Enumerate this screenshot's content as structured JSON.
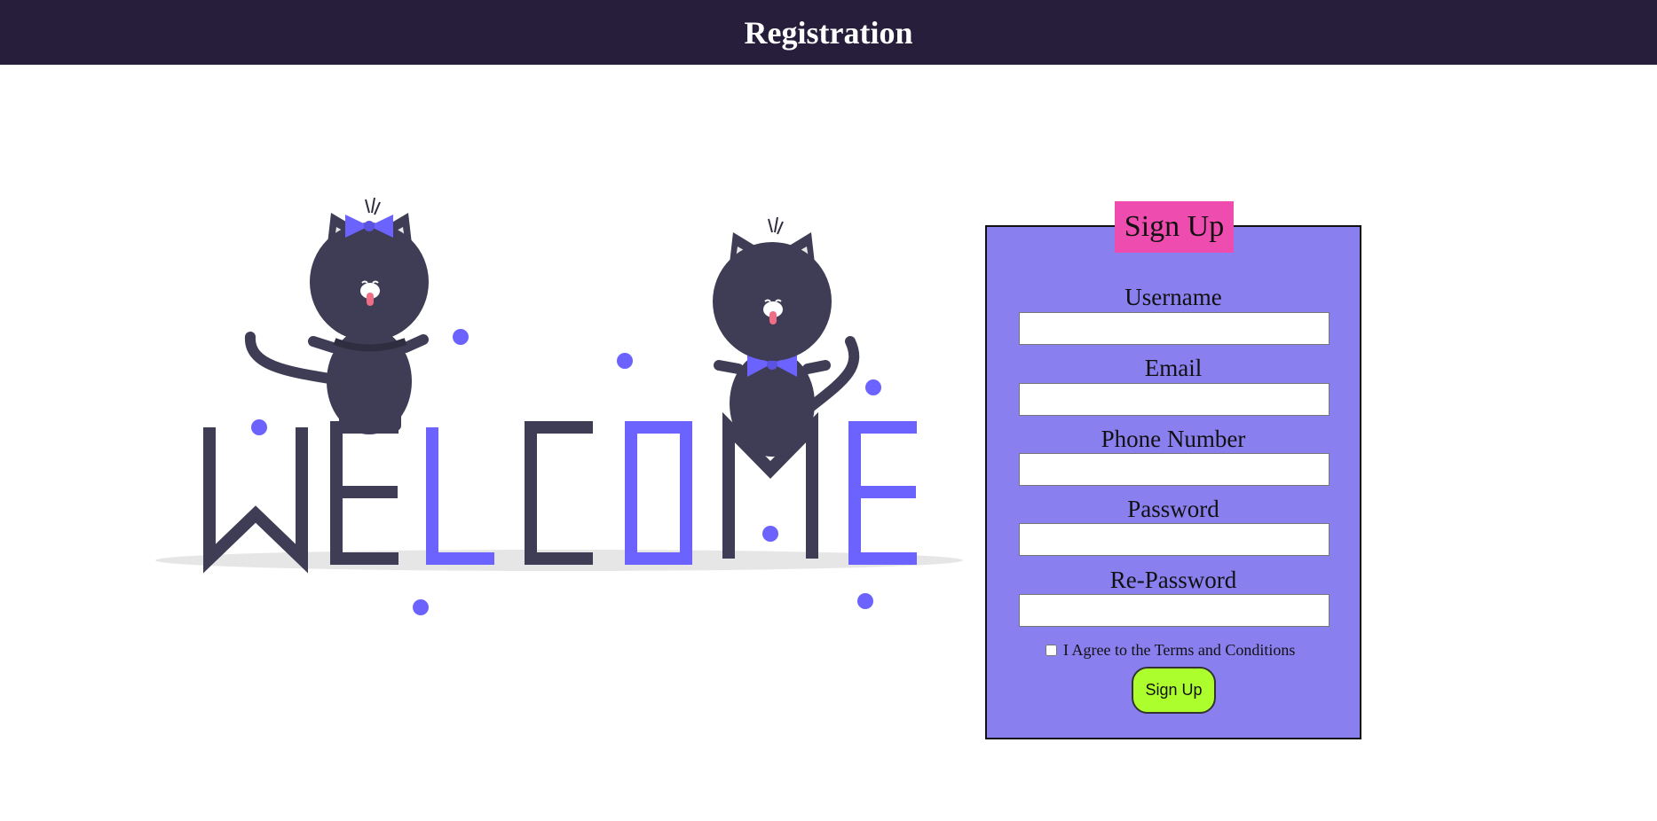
{
  "header": {
    "title": "Registration"
  },
  "illustration": {
    "description_icon": "welcome-cats-illustration",
    "welcome_text": "WELCOME",
    "colors": {
      "dark": "#3f3d56",
      "accent": "#6c63ff",
      "tongue": "#f06d85",
      "shadow": "#e6e6e6"
    }
  },
  "form": {
    "legend": "Sign Up",
    "fields": [
      {
        "label": "Username",
        "value": "",
        "placeholder": ""
      },
      {
        "label": "Email",
        "value": "",
        "placeholder": ""
      },
      {
        "label": "Phone Number",
        "value": "",
        "placeholder": ""
      },
      {
        "label": "Password",
        "value": "",
        "placeholder": ""
      },
      {
        "label": "Re-Password",
        "value": "",
        "placeholder": ""
      }
    ],
    "terms_label": "I Agree to the Terms and Conditions",
    "terms_checked": false,
    "submit_label": "Sign Up"
  },
  "colors": {
    "header_bg": "#261e3b",
    "form_bg": "#8a7fee",
    "legend_bg": "#ee4cae",
    "button_bg": "#adfe2d"
  }
}
